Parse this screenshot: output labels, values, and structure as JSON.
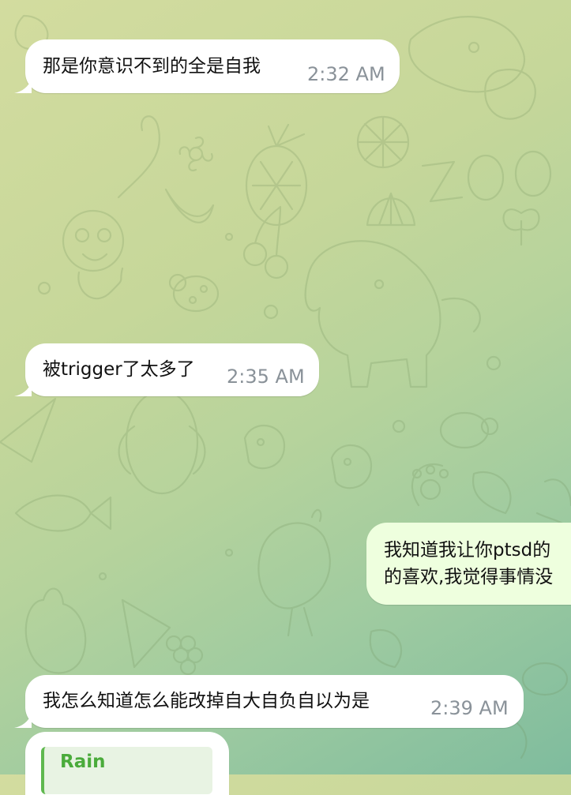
{
  "background": {
    "pattern": "doodle-animals",
    "gradient_colors": [
      "#d3dc9f",
      "#b6d39c",
      "#7fbc9e"
    ]
  },
  "messages": [
    {
      "direction": "incoming",
      "text": "那是你意识不到的全是自我",
      "time": "2:32 AM"
    },
    {
      "direction": "incoming",
      "text": "被trigger了太多了",
      "time": "2:35 AM"
    },
    {
      "direction": "outgoing",
      "line1": "我知道我让你ptsd的",
      "line2": "的喜欢,我觉得事情没"
    },
    {
      "direction": "incoming",
      "text": "我怎么知道怎么能改掉自大自负自以为是",
      "time": "2:39 AM"
    },
    {
      "direction": "incoming",
      "reply_sender": "Rain"
    }
  ],
  "colors": {
    "incoming_bubble": "#ffffff",
    "outgoing_bubble": "#eeffde",
    "reply_accent": "#4aab3b",
    "timestamp": "#8a9299"
  }
}
